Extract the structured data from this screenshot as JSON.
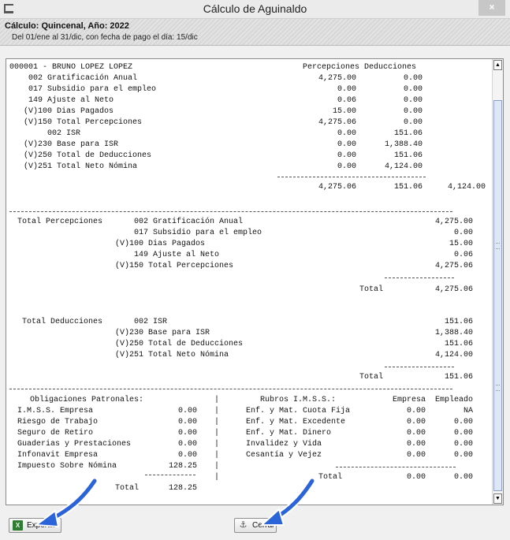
{
  "window": {
    "title": "Cálculo de Aguinaldo",
    "close_glyph": "×"
  },
  "header": {
    "calc_line": "Cálculo: Quincenal, Año: 2022",
    "period_line": "Del 01/ene al 31/dic, con fecha de pago el día: 15/dic"
  },
  "employee": {
    "name": "000001 - BRUNO LOPEZ LOPEZ",
    "col_percepciones": "Percepciones",
    "col_deducciones": "Deducciones",
    "rows": [
      {
        "label": "002 Gratificación Anual",
        "perc": "4,275.00",
        "ded": "0.00"
      },
      {
        "label": "017 Subsidio para el empleo",
        "perc": "0.00",
        "ded": "0.00"
      },
      {
        "label": "149 Ajuste al Neto",
        "perc": "0.06",
        "ded": "0.00"
      },
      {
        "label": "(V)100 Dias Pagados",
        "perc": "15.00",
        "ded": "0.00"
      },
      {
        "label": "(V)150 Total Percepciones",
        "perc": "4,275.06",
        "ded": "0.00"
      },
      {
        "label": "002 ISR",
        "perc": "0.00",
        "ded": "151.06"
      },
      {
        "label": "(V)230 Base para ISR",
        "perc": "0.00",
        "ded": "1,388.40"
      },
      {
        "label": "(V)250 Total de Deducciones",
        "perc": "0.00",
        "ded": "151.06"
      },
      {
        "label": "(V)251 Total Neto Nómina",
        "perc": "0.00",
        "ded": "4,124.00"
      }
    ],
    "totals": {
      "perc": "4,275.06",
      "ded": "151.06",
      "neto": "4,124.00"
    }
  },
  "total_percepciones": {
    "heading": "Total Percepciones",
    "rows": [
      {
        "label": "002 Gratificación Anual",
        "value": "4,275.00"
      },
      {
        "label": "017 Subsidio para el empleo",
        "value": "0.00"
      },
      {
        "label": "(V)100 Dias Pagados",
        "value": "15.00"
      },
      {
        "label": "149 Ajuste al Neto",
        "value": "0.06"
      },
      {
        "label": "(V)150 Total Percepciones",
        "value": "4,275.06"
      }
    ],
    "total_label": "Total",
    "total_value": "4,275.06"
  },
  "total_deducciones": {
    "heading": "Total Deducciones",
    "rows": [
      {
        "label": "002 ISR",
        "value": "151.06"
      },
      {
        "label": "(V)230 Base para ISR",
        "value": "1,388.40"
      },
      {
        "label": "(V)250 Total de Deducciones",
        "value": "151.06"
      },
      {
        "label": "(V)251 Total Neto Nómina",
        "value": "4,124.00"
      }
    ],
    "total_label": "Total",
    "total_value": "151.06"
  },
  "obligaciones": {
    "heading": "Obligaciones Patronales:",
    "rows": [
      {
        "label": "I.M.S.S. Empresa",
        "value": "0.00"
      },
      {
        "label": "Riesgo de Trabajo",
        "value": "0.00"
      },
      {
        "label": "Seguro de Retiro",
        "value": "0.00"
      },
      {
        "label": "Guaderias y Prestaciones",
        "value": "0.00"
      },
      {
        "label": "Infonavit Empresa",
        "value": "0.00"
      },
      {
        "label": "Impuesto Sobre Nómina",
        "value": "128.25"
      }
    ],
    "total_label": "Total",
    "total_value": "128.25"
  },
  "imss": {
    "heading": "Rubros I.M.S.S.:",
    "col_empresa": "Empresa",
    "col_empleado": "Empleado",
    "rows": [
      {
        "label": "Enf. y Mat. Cuota Fija",
        "empresa": "0.00",
        "empleado": "NA"
      },
      {
        "label": "Enf. y Mat. Excedente",
        "empresa": "0.00",
        "empleado": "0.00"
      },
      {
        "label": "Enf. y Mat. Dinero",
        "empresa": "0.00",
        "empleado": "0.00"
      },
      {
        "label": "Invalidez y Vida",
        "empresa": "0.00",
        "empleado": "0.00"
      },
      {
        "label": "Cesantía y Vejez",
        "empresa": "0.00",
        "empleado": "0.00"
      }
    ],
    "total_label": "Total",
    "total_empresa": "0.00",
    "total_empleado": "0.00"
  },
  "buttons": {
    "exportar": "Exportar",
    "cerrar": "Cerrar"
  },
  "icons": {
    "export": "excel-icon",
    "close": "door-exit-icon"
  },
  "colors": {
    "pointer_arrow": "#2b63d9"
  }
}
